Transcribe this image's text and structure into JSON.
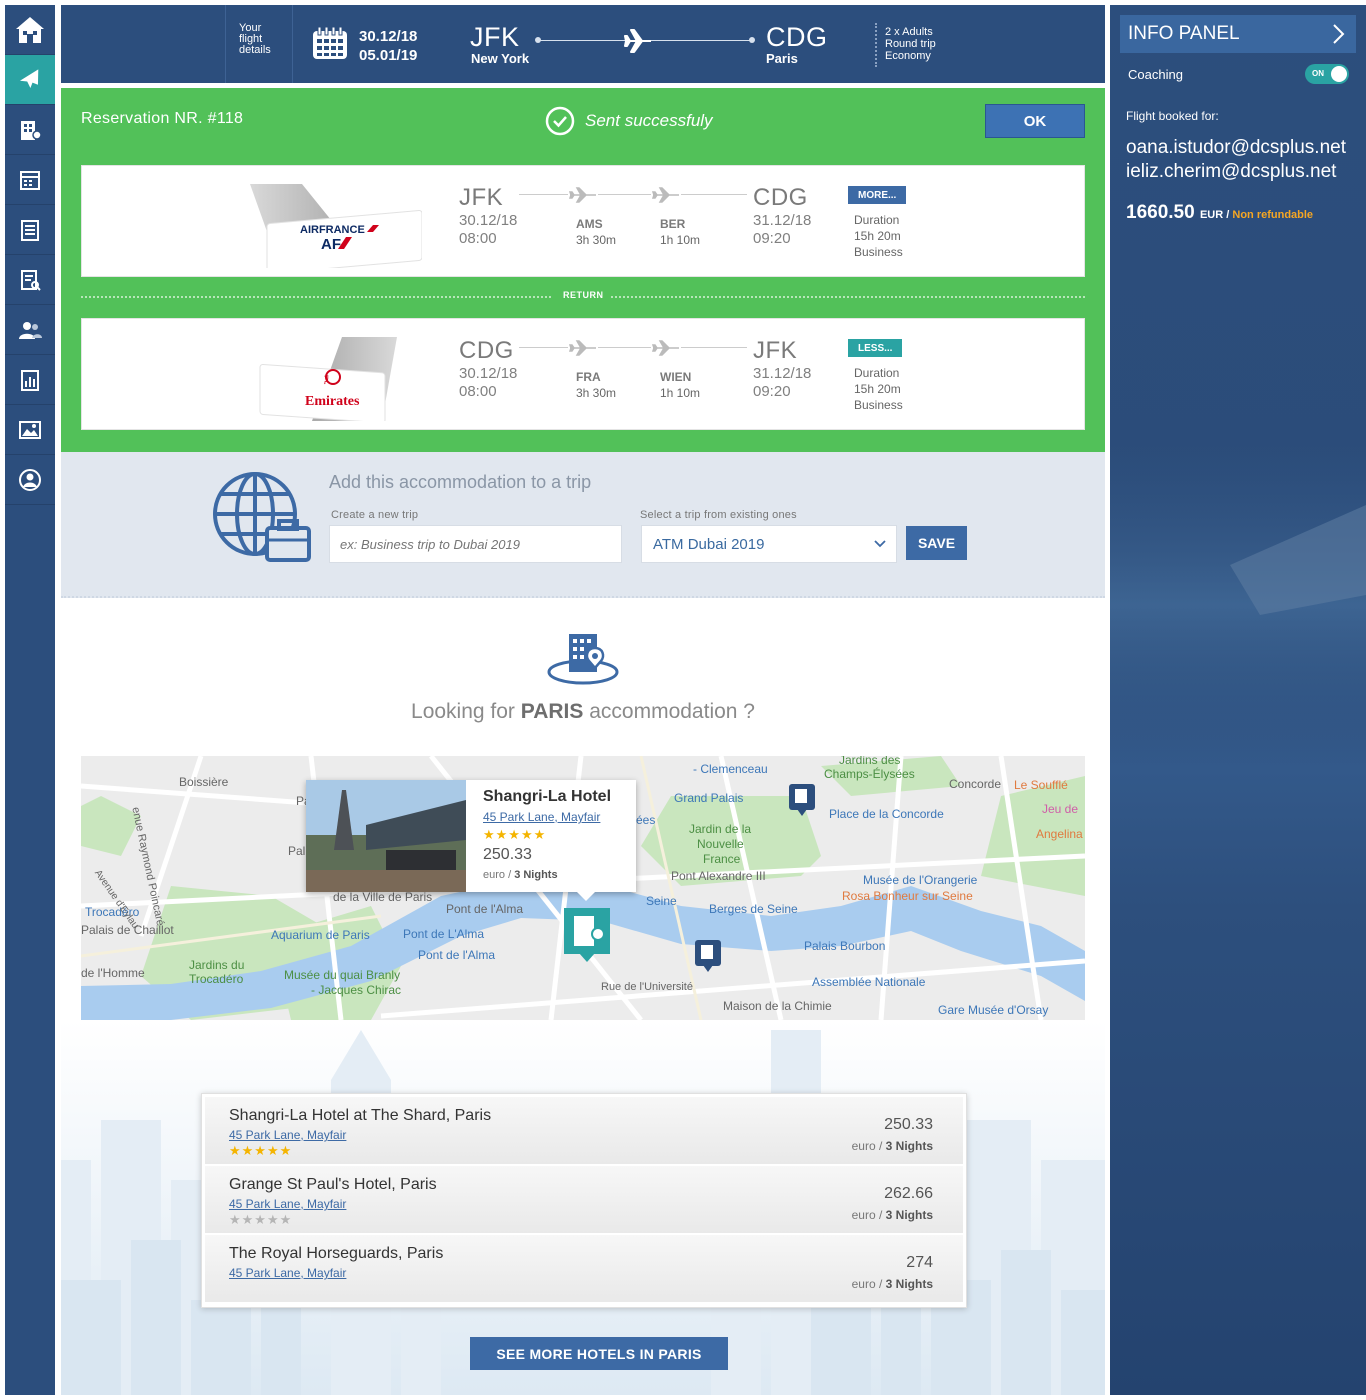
{
  "sidebar": {
    "items": [
      {
        "name": "home",
        "icon": "home-icon"
      },
      {
        "name": "flights",
        "icon": "plane-icon",
        "active": true
      },
      {
        "name": "hotels",
        "icon": "building-icon"
      },
      {
        "name": "calendar",
        "icon": "calendar-icon"
      },
      {
        "name": "documents",
        "icon": "document-icon"
      },
      {
        "name": "reports",
        "icon": "report-search-icon"
      },
      {
        "name": "users",
        "icon": "users-icon"
      },
      {
        "name": "statistics",
        "icon": "chart-icon"
      },
      {
        "name": "gallery",
        "icon": "image-icon"
      },
      {
        "name": "profile",
        "icon": "user-circle-icon"
      }
    ]
  },
  "header": {
    "details_line1": "Your",
    "details_line2": "flight",
    "details_line3": "details",
    "date_depart": "30.12/18",
    "date_return": "05.01/19",
    "from_code": "JFK",
    "from_city": "New York",
    "to_code": "CDG",
    "to_city": "Paris",
    "pax": "2 x Adults",
    "trip_type": "Round trip",
    "cabin": "Economy"
  },
  "reservation": {
    "number_label": "Reservation NR. #118",
    "status": "Sent successfuly",
    "ok_label": "OK",
    "return_label": "RETURN",
    "outbound": {
      "airline": "AIRFRANCE",
      "from_code": "JFK",
      "from_date": "30.12/18",
      "from_time": "08:00",
      "stop1_code": "AMS",
      "stop1_dur": "3h 30m",
      "stop2_code": "BER",
      "stop2_dur": "1h 10m",
      "to_code": "CDG",
      "to_date": "31.12/18",
      "to_time": "09:20",
      "badge": "MORE...",
      "duration_label": "Duration",
      "duration": "15h 20m",
      "cabin": "Business"
    },
    "inbound": {
      "airline": "Emirates",
      "from_code": "CDG",
      "from_date": "30.12/18",
      "from_time": "08:00",
      "stop1_code": "FRA",
      "stop1_dur": "3h 30m",
      "stop2_code": "WIEN",
      "stop2_dur": "1h 10m",
      "to_code": "JFK",
      "to_date": "31.12/18",
      "to_time": "09:20",
      "badge": "LESS...",
      "duration_label": "Duration",
      "duration": "15h 20m",
      "cabin": "Business"
    }
  },
  "trip": {
    "title": "Add this accommodation to a trip",
    "new_label": "Create a new trip",
    "new_placeholder": "ex: Business trip to Dubai 2019",
    "existing_label": "Select a trip from existing ones",
    "existing_value": "ATM Dubai 2019",
    "save_label": "SAVE"
  },
  "accommodation": {
    "title_pre": "Looking for ",
    "title_city": "PARIS",
    "title_post": " accommodation ?"
  },
  "map": {
    "labels": [
      "Boissière",
      "Trocadéro",
      "Palais de Chaillot",
      "de l'Homme",
      "Jardins du",
      "Trocadéro",
      "Aquarium de Paris",
      "Musée du quai Branly",
      "- Jacques Chirac",
      "de la Ville de Paris",
      "Pont de l'Alma",
      "Pont de L'Alma",
      "Pont de l'Alma",
      "Seine",
      "Berges de Seine",
      "Rue de l'Université",
      "Maison de la Chimie",
      "Palais Bourbon",
      "Assemblée Nationale",
      "Gare Musée d'Orsay",
      "Grand Palais",
      "Jardin de la",
      "Nouvelle",
      "France",
      "Pont Alexandre III",
      "Musée de l'Orangerie",
      "Rosa Bonheur sur Seine",
      "Place de la Concorde",
      "Concorde",
      "Le Soufflé",
      "Jeu de",
      "Angelina",
      "Jardins des",
      "Champs-Élysées",
      "- Clemenceau",
      "enue Raymond Poincaré",
      "Avenue d'Eylau",
      "Pal",
      "Pa",
      "ées"
    ],
    "popup": {
      "name": "Shangri-La Hotel",
      "address": "45 Park Lane, Mayfair",
      "stars": "★★★★★",
      "price": "250.33",
      "per_pre": "euro / ",
      "per_nights": "3 Nights"
    }
  },
  "hotels": [
    {
      "name": "Shangri-La Hotel at The Shard, Paris",
      "address": "45 Park Lane, Mayfair",
      "stars": "★★★★★",
      "star_color": "#f4b400",
      "price": "250.33",
      "per_pre": "euro / ",
      "nights": "3 Nights"
    },
    {
      "name": "Grange St Paul's Hotel, Paris",
      "address": "45 Park Lane, Mayfair",
      "stars": "★★★★★",
      "star_color": "#b5b5b5",
      "price": "262.66",
      "per_pre": "euro / ",
      "nights": "3 Nights"
    },
    {
      "name": "The Royal Horseguards, Paris",
      "address": "45 Park Lane, Mayfair",
      "stars": "",
      "star_color": "#b5b5b5",
      "price": "274",
      "per_pre": "euro / ",
      "nights": "3 Nights"
    }
  ],
  "more_button": "SEE MORE HOTELS IN PARIS",
  "info_panel": {
    "title": "INFO PANEL",
    "coaching_label": "Coaching",
    "toggle_text": "ON",
    "booked_label": "Flight booked for:",
    "emails": [
      "oana.istudor@dcsplus.net",
      "ieliz.cherim@dcsplus.net"
    ],
    "total": "1660.50",
    "currency": "EUR",
    "separator": " / ",
    "refund": "Non refundable"
  },
  "colors": {
    "sidebar": "#2c4e7d",
    "active": "#2aa3a3",
    "success": "#52c159",
    "button": "#3d6aa5",
    "warning": "#f6a623"
  }
}
